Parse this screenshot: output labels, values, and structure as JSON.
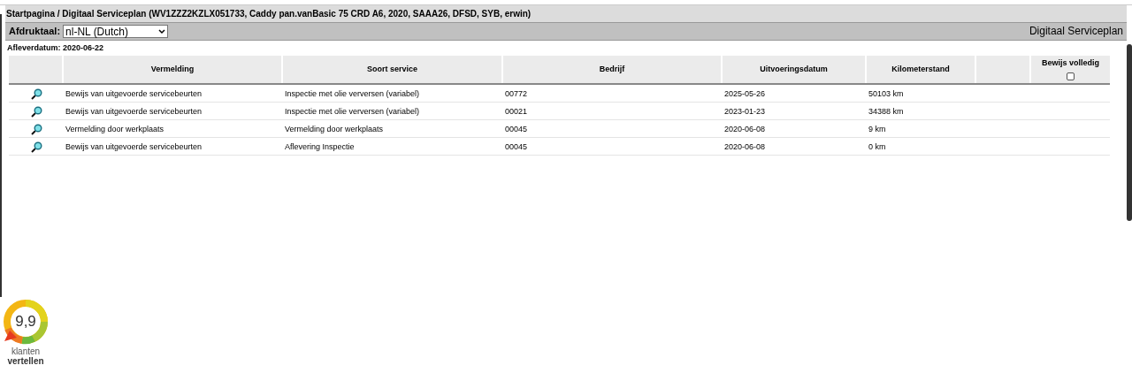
{
  "breadcrumb": "Startpagina / Digitaal Serviceplan (WV1ZZZ2KZLX051733, Caddy pan.vanBasic 75 CRD A6, 2020, SAAA26, DFSD, SYB, erwin)",
  "toolbar": {
    "label": "Afdruktaal:",
    "select_value": "nl-NL (Dutch)",
    "title": "Digitaal Serviceplan"
  },
  "delivery_date": "Afleverdatum: 2020-06-22",
  "table": {
    "columns": [
      "Vermelding",
      "Soort service",
      "Bedrijf",
      "Uitvoeringsdatum",
      "Kilometerstand"
    ],
    "proof_column": {
      "label": "Bewijs volledig",
      "checked": false
    },
    "rows": [
      {
        "vermelding": "Bewijs van uitgevoerde servicebeurten",
        "soort": "Inspectie met olie verversen (variabel)",
        "bedrijf": "00772",
        "datum": "2025-05-26",
        "km": "50103 km"
      },
      {
        "vermelding": "Bewijs van uitgevoerde servicebeurten",
        "soort": "Inspectie met olie verversen (variabel)",
        "bedrijf": "00021",
        "datum": "2023-01-23",
        "km": "34388 km"
      },
      {
        "vermelding": "Vermelding door werkplaats",
        "soort": "Vermelding door werkplaats",
        "bedrijf": "00045",
        "datum": "2020-06-08",
        "km": "9 km"
      },
      {
        "vermelding": "Bewijs van uitgevoerde servicebeurten",
        "soort": "Aflevering Inspectie",
        "bedrijf": "00045",
        "datum": "2020-06-08",
        "km": "0 km"
      }
    ]
  },
  "rating_badge": {
    "score": "9,9",
    "line1": "klanten",
    "line2": "vertellen"
  }
}
